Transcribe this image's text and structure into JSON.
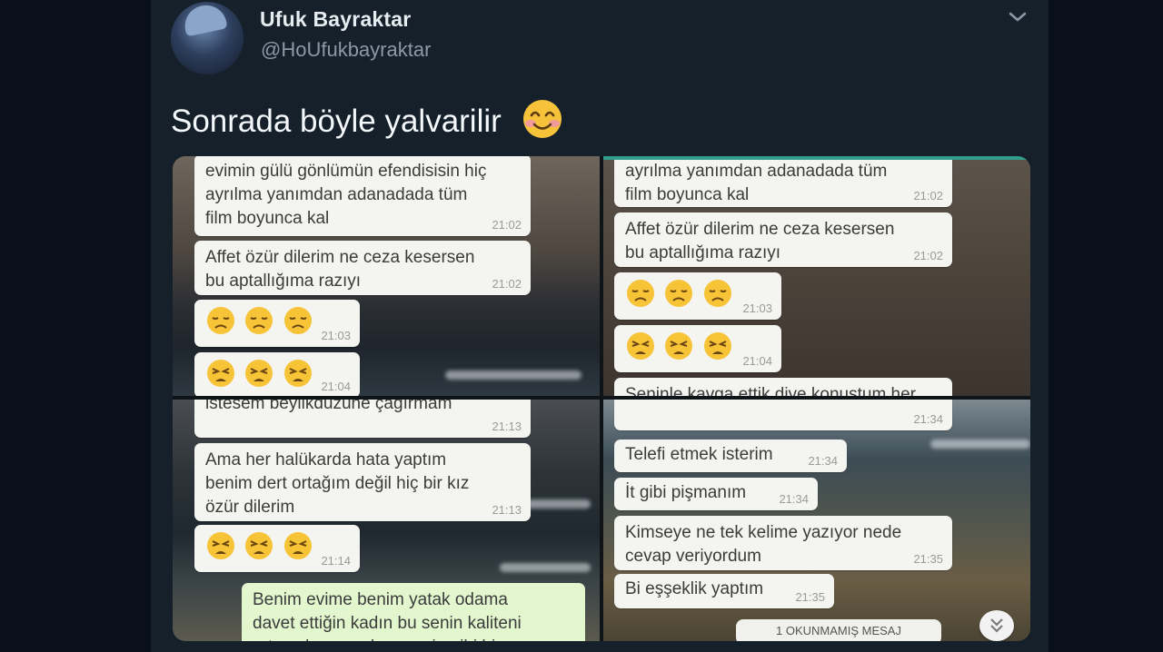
{
  "tweet": {
    "display_name": "Ufuk Bayraktar",
    "handle": "@HoUfukbayraktar",
    "text": "Sonrada böyle yalvarilir",
    "text_emoji": "smiling-face-with-smiling-eyes"
  },
  "media": {
    "panels": {
      "top_left": {
        "messages": [
          {
            "text": "evimin gülü gönlümün efendisisin hiç\nayrılma yanımdan adanadada tüm\nfilm boyunca kal",
            "time": "21:02"
          },
          {
            "text": "Affet özür dilerim ne ceza kesersen\nbu aptallığıma razıyı",
            "time": "21:02"
          },
          {
            "emoji": [
              "disappointed-face",
              "disappointed-face",
              "disappointed-face"
            ],
            "time": "21:03"
          },
          {
            "emoji": [
              "persevering-face",
              "persevering-face",
              "persevering-face"
            ],
            "time": "21:04"
          }
        ]
      },
      "top_right": {
        "messages": [
          {
            "text": "ayrılma yanımdan adanadada tüm\nfilm boyunca kal",
            "time": "21:02"
          },
          {
            "text": "Affet özür dilerim ne ceza kesersen\nbu aptallığıma razıyı",
            "time": "21:02"
          },
          {
            "emoji": [
              "disappointed-face",
              "disappointed-face",
              "disappointed-face"
            ],
            "time": "21:03"
          },
          {
            "emoji": [
              "persevering-face",
              "persevering-face",
              "persevering-face"
            ],
            "time": "21:04"
          },
          {
            "text": "Seninle kavga ettik diye konuştum her",
            "time": ""
          }
        ]
      },
      "bottom_left": {
        "messages": [
          {
            "text": "istesem beylikdüzüne çağırmam",
            "time": "21:13"
          },
          {
            "text": "Ama her halükarda hata yaptım\nbenim dert ortağım değil hiç bir kız\nözür dilerim",
            "time": "21:13"
          },
          {
            "emoji": [
              "persevering-face",
              "persevering-face",
              "persevering-face"
            ],
            "time": "21:14"
          },
          {
            "text": "Benim evime benim yatak odama\ndavet ettiğin kadın bu senin kaliteni\nortaya koyuyor ben senin gibi bir",
            "time": "",
            "outgoing": true
          }
        ]
      },
      "bottom_right": {
        "messages": [
          {
            "text": "",
            "time": "21:34"
          },
          {
            "text": "Telefi etmek isterim",
            "time": "21:34"
          },
          {
            "text": "İt gibi pişmanım",
            "time": "21:34"
          },
          {
            "text": "Kimseye ne tek kelime yazıyor nede\ncevap veriyordum",
            "time": "21:35"
          },
          {
            "text": "Bi eşşeklik yaptım",
            "time": "21:35"
          }
        ],
        "unread_label": "1 OKUNMAMIŞ MESAJ"
      }
    }
  },
  "colors": {
    "background": "#15202b",
    "page": "#0a101a",
    "bubble_incoming": "#f4f4f1",
    "bubble_outgoing": "#e3f7cf",
    "accent": "#2f9e8a"
  },
  "icons": {
    "tweet_menu": "chevron-down-icon",
    "scroll_down": "double-chevron-down-icon"
  }
}
